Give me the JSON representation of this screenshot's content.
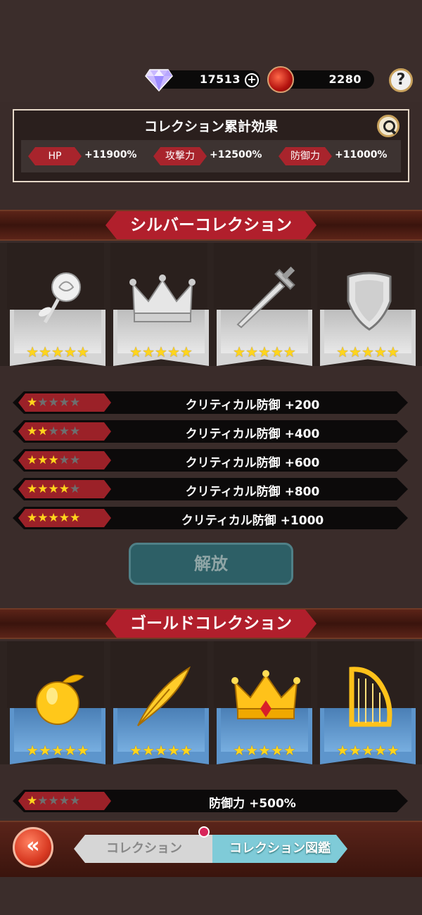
{
  "currencies": {
    "gems": "17513",
    "coins": "2280"
  },
  "summary": {
    "title": "コレクション累計効果",
    "stats": [
      {
        "label": "HP",
        "value": "+11900%"
      },
      {
        "label": "攻撃力",
        "value": "+12500%"
      },
      {
        "label": "防御力",
        "value": "+11000%"
      }
    ]
  },
  "silver": {
    "title": "シルバーコレクション",
    "items": [
      {
        "icon": "rose-icon",
        "stars": 5
      },
      {
        "icon": "crown-icon",
        "stars": 5
      },
      {
        "icon": "sword-icon",
        "stars": 5
      },
      {
        "icon": "shield-icon",
        "stars": 5
      }
    ],
    "rewards": [
      {
        "stars": 1,
        "text": "クリティカル防御 +200"
      },
      {
        "stars": 2,
        "text": "クリティカル防御 +400"
      },
      {
        "stars": 3,
        "text": "クリティカル防御 +600"
      },
      {
        "stars": 4,
        "text": "クリティカル防御 +800"
      },
      {
        "stars": 5,
        "text": "クリティカル防御 +1000"
      }
    ],
    "unlock_label": "解放"
  },
  "gold": {
    "title": "ゴールドコレクション",
    "items": [
      {
        "icon": "apple-icon",
        "stars": 5
      },
      {
        "icon": "quill-icon",
        "stars": 5
      },
      {
        "icon": "crown-icon",
        "stars": 5
      },
      {
        "icon": "harp-icon",
        "stars": 5
      }
    ],
    "rewards": [
      {
        "stars": 1,
        "text": "防御力 +500%"
      }
    ]
  },
  "nav": {
    "back_label": "«",
    "tab_collection": "コレクション",
    "tab_catalog": "コレクション図鑑"
  },
  "colors": {
    "accent_red": "#b11f2c",
    "gold_banner": "#5d95cc",
    "silver_banner": "#d5d5d5",
    "star": "#ffd51c"
  }
}
